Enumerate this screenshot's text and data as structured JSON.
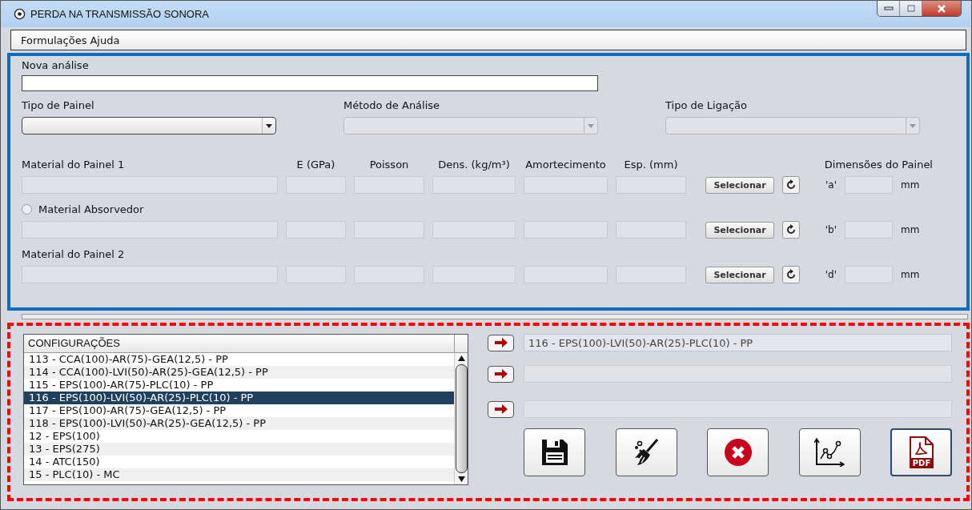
{
  "window": {
    "title": "PERDA NA TRANSMISSÃO SONORA"
  },
  "menu": [
    "Formulações",
    "Ajuda"
  ],
  "new_analysis": {
    "label": "Nova análise"
  },
  "dropdowns": [
    {
      "label": "Tipo de Painel",
      "disabled": false
    },
    {
      "label": "Método de Análise",
      "disabled": true
    },
    {
      "label": "Tipo de Ligação",
      "disabled": true
    }
  ],
  "material_columns": [
    "E (GPa)",
    "Poisson",
    "Dens. (kg/m³)",
    "Amortecimento",
    "Esp. (mm)"
  ],
  "dimensions_label": "Dimensões do Painel",
  "material_rows": [
    {
      "kind": "label",
      "label": "Material do Painel 1",
      "button": "Selecionar",
      "dimension": "'a'",
      "unit": "mm"
    },
    {
      "kind": "radio",
      "label": "Material Absorvedor",
      "checked": false,
      "button": "Selecionar",
      "dimension": "'b'",
      "unit": "mm"
    },
    {
      "kind": "label",
      "label": "Material do Painel 2",
      "button": "Selecionar",
      "dimension": "'d'",
      "unit": "mm"
    }
  ],
  "configurations": {
    "header": "CONFIGURAÇÕES",
    "rows": [
      {
        "text": "113 - CCA(100)-AR(75)-GEA(12,5) - PP",
        "selected": false
      },
      {
        "text": "114 - CCA(100)-LVI(50)-AR(25)-GEA(12,5) - PP",
        "selected": false
      },
      {
        "text": "115 - EPS(100)-AR(75)-PLC(10) - PP",
        "selected": false
      },
      {
        "text": "116 - EPS(100)-LVI(50)-AR(25)-PLC(10) - PP",
        "selected": true
      },
      {
        "text": "117 - EPS(100)-AR(75)-GEA(12,5) - PP",
        "selected": false
      },
      {
        "text": "118 - EPS(100)-LVI(50)-AR(25)-GEA(12,5) - PP",
        "selected": false
      },
      {
        "text": "12 - EPS(100)",
        "selected": false
      },
      {
        "text": "13 - EPS(275)",
        "selected": false
      },
      {
        "text": "14 - ATC(150)",
        "selected": false
      },
      {
        "text": "15 - PLC(10) - MC",
        "selected": false
      }
    ]
  },
  "slots": [
    {
      "value": "116 - EPS(100)-LVI(50)-AR(25)-PLC(10) - PP"
    }
  ],
  "actions": [
    {
      "kind": "save"
    },
    {
      "kind": "clean"
    },
    {
      "kind": "cancel"
    },
    {
      "kind": "chart"
    },
    {
      "kind": "pdf",
      "label": "PDF"
    }
  ]
}
